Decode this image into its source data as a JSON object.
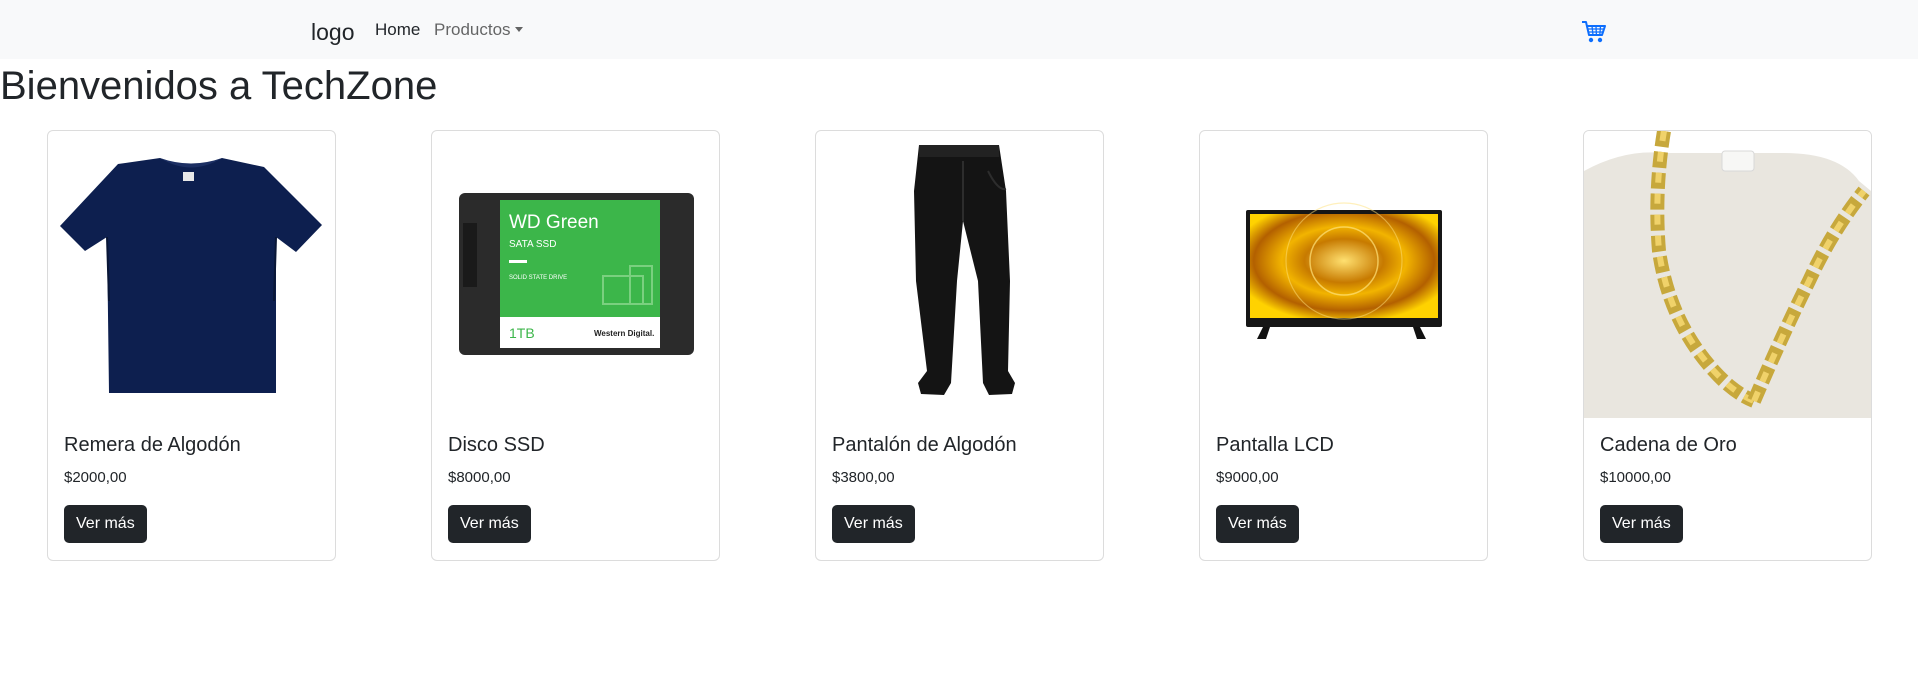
{
  "navbar": {
    "logo": "logo",
    "home": "Home",
    "productos": "Productos",
    "cart_icon": "cart-icon",
    "accent_color": "#0d6efd"
  },
  "page": {
    "title": "Bienvenidos a TechZone"
  },
  "products": [
    {
      "name": "Remera de Algodón",
      "price": "$2000,00",
      "button": "Ver más",
      "image": "navy-t-shirt-image"
    },
    {
      "name": "Disco SSD",
      "price": "$8000,00",
      "button": "Ver más",
      "image": "wd-green-ssd-image",
      "image_text": {
        "brand": "WD Green",
        "type": "SATA SSD",
        "sub": "SOLID STATE DRIVE",
        "capacity": "1TB",
        "maker": "Western Digital."
      }
    },
    {
      "name": "Pantalón de Algodón",
      "price": "$3800,00",
      "button": "Ver más",
      "image": "black-pants-image"
    },
    {
      "name": "Pantalla LCD",
      "price": "$9000,00",
      "button": "Ver más",
      "image": "lcd-tv-image"
    },
    {
      "name": "Cadena de Oro",
      "price": "$10000,00",
      "button": "Ver más",
      "image": "gold-chain-image"
    }
  ]
}
